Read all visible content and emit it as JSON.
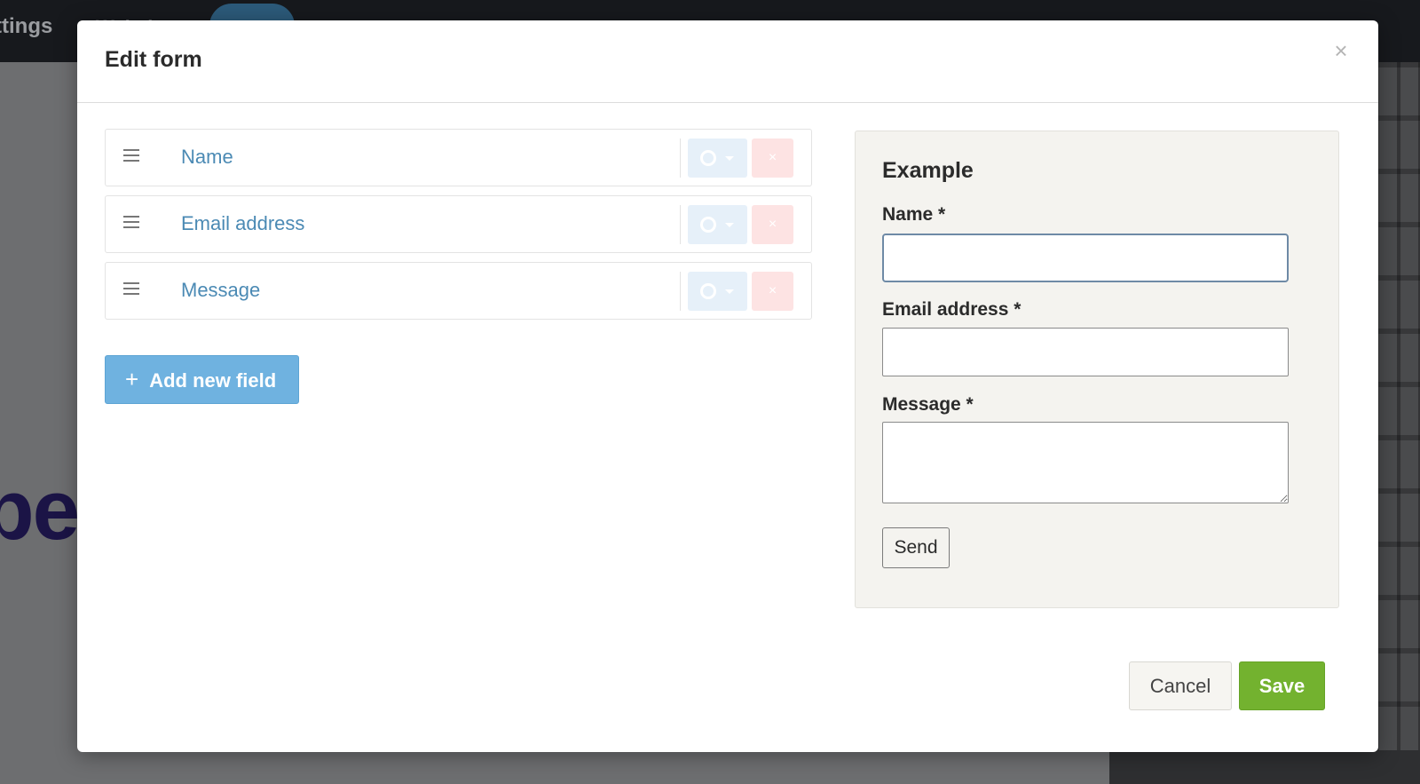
{
  "background": {
    "nav_text": "ttings",
    "hero_text": "pe"
  },
  "modal": {
    "title": "Edit form",
    "close_label": "×"
  },
  "fields": [
    {
      "label": "Name"
    },
    {
      "label": "Email address"
    },
    {
      "label": "Message"
    }
  ],
  "field_actions": {
    "delete_label": "×"
  },
  "add_field": {
    "icon": "+",
    "label": "Add new field"
  },
  "example": {
    "title": "Example",
    "name_label": "Name *",
    "name_value": "",
    "email_label": "Email address *",
    "email_value": "",
    "message_label": "Message *",
    "message_value": "",
    "send_label": "Send"
  },
  "footer": {
    "cancel_label": "Cancel",
    "save_label": "Save"
  },
  "colors": {
    "field_label": "#4b8ab4",
    "add_button": "#6fb2e0",
    "save_button": "#73b22f",
    "example_panel": "#f4f3ef"
  }
}
